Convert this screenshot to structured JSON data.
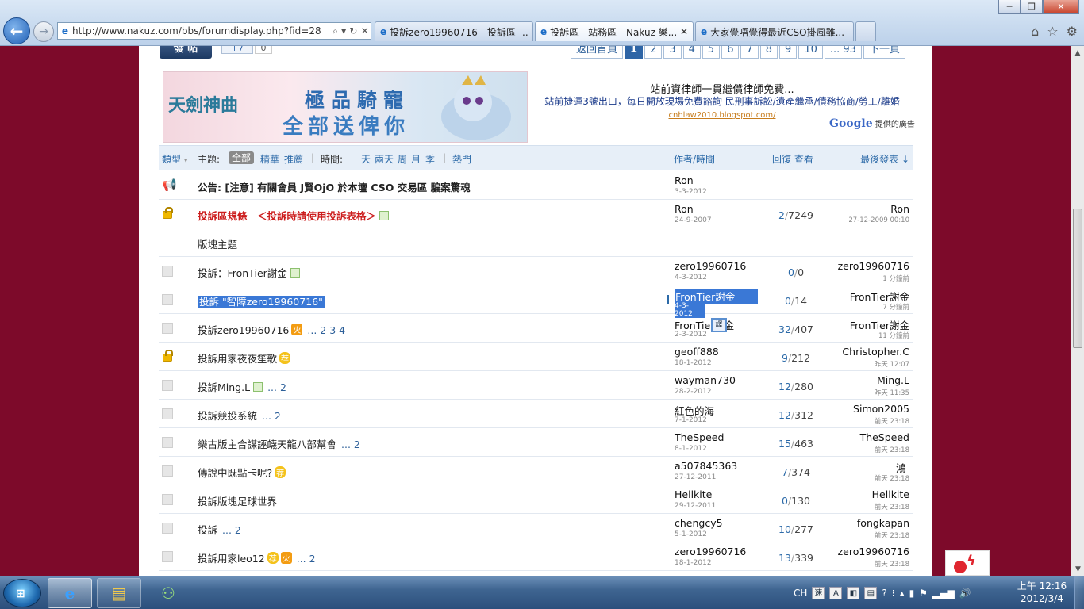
{
  "browser": {
    "address": "http://www.nakuz.com/bbs/forumdisplay.php?fid=28",
    "tabs": [
      {
        "title": "投訴zero19960716 - 投訴區 -..."
      },
      {
        "title": "投訴區 - 站務區 - Nakuz 樂..."
      },
      {
        "title": "大家覺唔覺得最近CSO掛風雖..."
      }
    ],
    "back_icon": "back-arrow-icon",
    "home_icon": "home-icon"
  },
  "forum": {
    "post_button": "發 帖",
    "plus_label": "+7",
    "plus_count": "0",
    "pager": {
      "back": "返回首頁",
      "pages": [
        "1",
        "2",
        "3",
        "4",
        "5",
        "6",
        "7",
        "8",
        "9",
        "10",
        "... 93"
      ],
      "current": "1",
      "next": "下一頁"
    },
    "banner": {
      "logo": "天劍神曲",
      "line1": "極品騎寵",
      "line2": "全部送俾你"
    },
    "google_ad": {
      "title": "站前資律師一貫繼償律師免費...",
      "body": "站前捷運3號出口，每日開放現場免費諮詢 民刑事訴訟/遺產繼承/債務協商/勞工/離婚",
      "url": "cnhlaw2010.blogspot.com/",
      "by_prefix": "Google",
      "by_suffix": "提供的廣告"
    },
    "header": {
      "type": "類型",
      "topic": "主題:",
      "all": "全部",
      "digest": "精華",
      "recommend": "推薦",
      "time": "時間:",
      "day1": "一天",
      "day2": "兩天",
      "week": "周",
      "month": "月",
      "season": "季",
      "hot": "熱門",
      "author_time": "作者/時間",
      "reply_view": "回復 查看",
      "last_post": "最後發表"
    },
    "section_label": "版塊主題",
    "rows": [
      {
        "icon": "announcement-icon",
        "title": "公告: [注意] 有關會員 J賢OjO 於本壇 CSO 交易區 騙案驚魂",
        "author": "Ron",
        "date": "3-3-2012",
        "replies": "",
        "views": "",
        "last": "",
        "last_time": ""
      },
      {
        "icon": "lock-icon",
        "title": "投訴區規條　＜投訴時請使用投訴表格＞",
        "author": "Ron",
        "date": "24-9-2007",
        "replies": "2",
        "views": "7249",
        "last": "Ron",
        "last_time": "27-12-2009 00:10"
      },
      {
        "icon": "doc-icon",
        "title": "投訴：FronTier謝金",
        "author": "zero19960716",
        "date": "4-3-2012",
        "replies": "0",
        "views": "0",
        "last": "zero19960716",
        "last_time": "1 分鐘前"
      },
      {
        "icon": "doc-icon",
        "title": "投訴 \"智障zero19960716\"",
        "author": "FronTier謝金",
        "date": "4-3-2012",
        "replies": "0",
        "views": "14",
        "last": "FronTier謝金",
        "last_time": "7 分鐘前"
      },
      {
        "icon": "doc-icon",
        "title": "投訴zero19960716",
        "pages": "... 2  3  4",
        "author": "FronTier謝金",
        "date": "2-3-2012",
        "replies": "32",
        "views": "407",
        "last": "FronTier謝金",
        "last_time": "11 分鐘前"
      },
      {
        "icon": "lock-icon",
        "title": "投訴用家夜夜笙歌",
        "author": "geoff888",
        "date": "18-1-2012",
        "replies": "9",
        "views": "212",
        "last": "Christopher.C",
        "last_time": "昨天 12:07"
      },
      {
        "icon": "doc-icon",
        "title": "投訴Ming.L",
        "pages": "... 2",
        "author": "wayman730",
        "date": "28-2-2012",
        "replies": "12",
        "views": "280",
        "last": "Ming.L",
        "last_time": "昨天 11:35"
      },
      {
        "icon": "doc-icon",
        "title": "投訴競投系統",
        "pages": "... 2",
        "author": "紅色的海",
        "date": "7-1-2012",
        "replies": "12",
        "views": "312",
        "last": "Simon2005",
        "last_time": "前天 23:18"
      },
      {
        "icon": "doc-icon",
        "title": "樂古版主合謀誣衊天龍八部幫會",
        "pages": "... 2",
        "author": "TheSpeed",
        "date": "8-1-2012",
        "replies": "15",
        "views": "463",
        "last": "TheSpeed",
        "last_time": "前天 23:18"
      },
      {
        "icon": "doc-icon",
        "title": "傳說中既點卡呢?",
        "author": "a507845363",
        "date": "27-12-2011",
        "replies": "7",
        "views": "374",
        "last": "鴻-",
        "last_time": "前天 23:18"
      },
      {
        "icon": "doc-icon",
        "title": "投訴版塊足球世界",
        "author": "Hellkite",
        "date": "29-12-2011",
        "replies": "0",
        "views": "130",
        "last": "Hellkite",
        "last_time": "前天 23:18"
      },
      {
        "icon": "doc-icon",
        "title": "投訴",
        "pages": "... 2",
        "author": "chengcy5",
        "date": "5-1-2012",
        "replies": "10",
        "views": "277",
        "last": "fongkapan",
        "last_time": "前天 23:18"
      },
      {
        "icon": "doc-icon",
        "title": "投訴用家leo12",
        "pages": "... 2",
        "author": "zero19960716",
        "date": "18-1-2012",
        "replies": "13",
        "views": "339",
        "last": "zero19960716",
        "last_time": "前天 23:18"
      }
    ],
    "badges": {
      "img": "圖",
      "hot": "火",
      "rec": "荐"
    }
  },
  "taskbar": {
    "lang": "CH",
    "time": "上午 12:16",
    "date": "2012/3/4"
  },
  "colors": {
    "page_bg": "#7d0a2a",
    "link_blue": "#2c6aa8",
    "header_bg": "#e7eff8",
    "selection": "#3a78d6"
  }
}
